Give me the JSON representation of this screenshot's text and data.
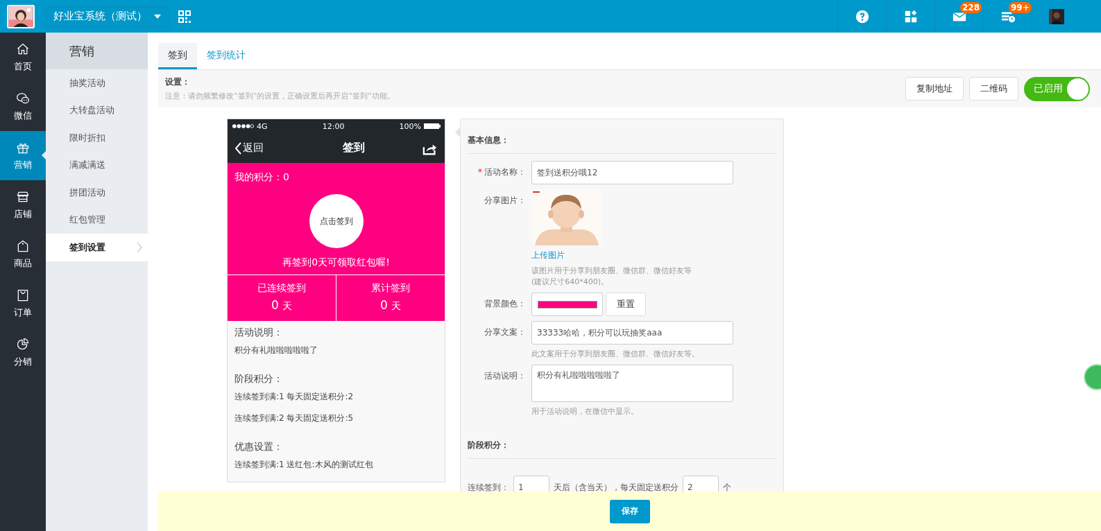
{
  "topbar": {
    "system_name": "好业宝系统（测试）",
    "badges": [
      {
        "kind": "help"
      },
      {
        "kind": "apps"
      },
      {
        "kind": "mail",
        "count": "228"
      },
      {
        "kind": "tasks",
        "count": "99+"
      },
      {
        "kind": "avatar"
      }
    ]
  },
  "nav": [
    {
      "label": "首页",
      "kind": "home",
      "selected": false
    },
    {
      "label": "微信",
      "kind": "chat",
      "selected": false
    },
    {
      "label": "营销",
      "kind": "gift",
      "selected": true
    },
    {
      "label": "店铺",
      "kind": "store",
      "selected": false
    },
    {
      "label": "商品",
      "kind": "tag",
      "selected": false
    },
    {
      "label": "订单",
      "kind": "bag",
      "selected": false
    },
    {
      "label": "分销",
      "kind": "pie",
      "selected": false
    }
  ],
  "submenu": {
    "title": "营销",
    "items": [
      {
        "label": "抽奖活动",
        "selected": false
      },
      {
        "label": "大转盘活动",
        "selected": false
      },
      {
        "label": "限时折扣",
        "selected": false
      },
      {
        "label": "满减满送",
        "selected": false
      },
      {
        "label": "拼团活动",
        "selected": false
      },
      {
        "label": "红包管理",
        "selected": false
      },
      {
        "label": "签到设置",
        "selected": true
      }
    ]
  },
  "tabs": [
    {
      "label": "签到",
      "selected": true
    },
    {
      "label": "签到统计",
      "selected": false
    }
  ],
  "settings": {
    "title": "设置：",
    "note": "注意：请勿频繁修改“签到”的设置，正确设置后再开启“签到”功能。",
    "buttons": [
      "复制地址",
      "二维码"
    ],
    "toggle": {
      "label": "已启用",
      "on": true
    }
  },
  "phone": {
    "network": "4G",
    "time": "12:00",
    "battery": "100%",
    "back": "返回",
    "title": "签到",
    "points": "我的积分：0",
    "checkin_button": "点击签到",
    "promo": "再签到0天可领取红包喔!",
    "stats": [
      {
        "label": "已连续签到",
        "value": "0",
        "unit": "天"
      },
      {
        "label": "累计签到",
        "value": "0",
        "unit": "天"
      }
    ],
    "sections": [
      {
        "title": "活动说明：",
        "lines": [
          "积分有礼啦啦啦啦啦了"
        ]
      },
      {
        "title": "阶段积分：",
        "lines": [
          "连续签到满:1 每天固定送积分:2",
          "连续签到满:2 每天固定送积分:5"
        ]
      },
      {
        "title": "优惠设置：",
        "lines": [
          "连续签到满:1 送红包:木风的测试红包"
        ]
      }
    ]
  },
  "form": {
    "section_title": "基本信息：",
    "fields": [
      {
        "kind": "text",
        "label": "活动名称：",
        "required": true,
        "value": "签到送积分哦12"
      },
      {
        "label": "分享图片：",
        "required": false,
        "link": "上传图片",
        "hints": [
          "该图片用于分享到朋友圈、微信群、微信好友等",
          "(建议尺寸640*400)。"
        ]
      },
      {
        "kind": "color",
        "label": "背景颜色：",
        "required": false,
        "color": "#ff0080",
        "button": "重置"
      },
      {
        "kind": "text",
        "label": "分享文案：",
        "required": false,
        "value": "33333哈哈，积分可以玩抽奖aaa",
        "hints": [
          "此文案用于分享到朋友圈、微信群、微信好友等。"
        ]
      },
      {
        "kind": "textarea",
        "label": "活动说明：",
        "required": false,
        "value": "积分有礼啦啦啦啦啦了",
        "hints": [
          "用于活动说明，在微信中显示。"
        ]
      }
    ],
    "stage": {
      "title": "阶段积分：",
      "rows": [
        {
          "label": "连续签到：",
          "days": "1",
          "middle": "天后（含当天），每天固定送积分",
          "points": "2",
          "unit": "个"
        }
      ]
    }
  },
  "save_button": "保存"
}
